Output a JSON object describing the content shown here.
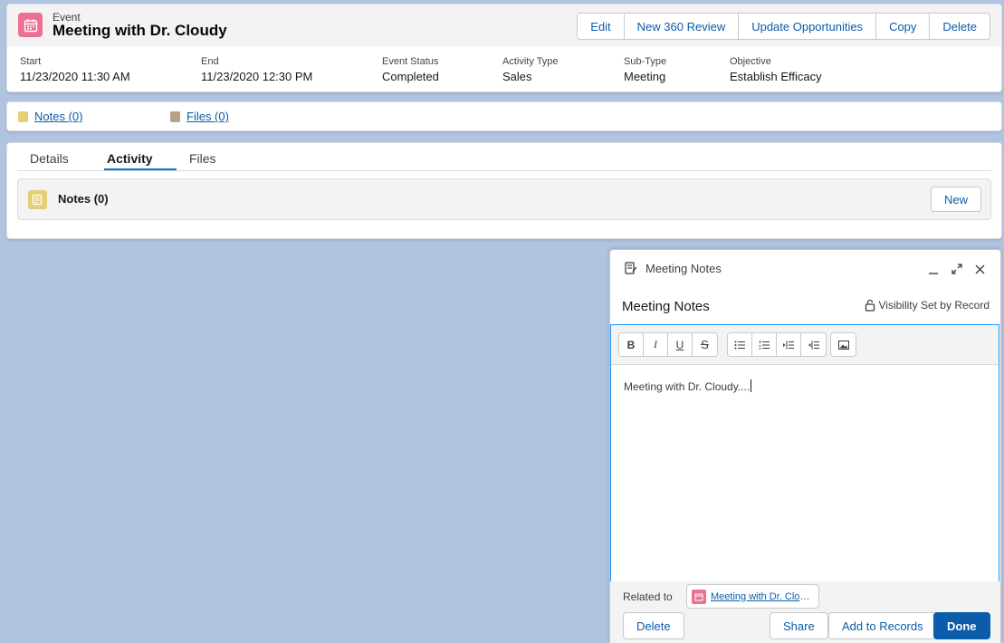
{
  "header": {
    "record_type": "Event",
    "title": "Meeting with Dr. Cloudy",
    "actions": [
      "Edit",
      "New 360 Review",
      "Update Opportunities",
      "Copy",
      "Delete"
    ],
    "fields": [
      {
        "label": "Start",
        "value": "11/23/2020 11:30 AM"
      },
      {
        "label": "End",
        "value": "11/23/2020 12:30 PM"
      },
      {
        "label": "Event Status",
        "value": "Completed"
      },
      {
        "label": "Activity Type",
        "value": "Sales"
      },
      {
        "label": "Sub-Type",
        "value": "Meeting"
      },
      {
        "label": "Objective",
        "value": "Establish Efficacy"
      }
    ]
  },
  "quicklinks": {
    "notes": "Notes (0)",
    "files": "Files (0)"
  },
  "tabs": {
    "items": [
      "Details",
      "Activity",
      "Files"
    ],
    "active": "Activity"
  },
  "notes_section": {
    "title": "Notes (0)",
    "new_label": "New"
  },
  "composer": {
    "header_title": "Meeting Notes",
    "note_title": "Meeting Notes",
    "visibility": "Visibility Set by Record",
    "body": "Meeting with Dr. Cloudy....",
    "related_label": "Related to",
    "related_record": "Meeting with Dr. Cloudy",
    "buttons": {
      "delete": "Delete",
      "share": "Share",
      "add_to_records": "Add to Records",
      "done": "Done"
    }
  },
  "colors": {
    "background": "#b0c4df",
    "event_icon": "#eb7092",
    "note_icon": "#e3d076",
    "link": "#0b5cab",
    "brand": "#0b5cab",
    "focus": "#1b96ff"
  },
  "icons": [
    "event-calendar-icon",
    "note-icon",
    "file-icon",
    "minimize-icon",
    "expand-icon",
    "close-icon",
    "lock-icon",
    "bold-icon",
    "italic-icon",
    "underline-icon",
    "strikethrough-icon",
    "bullet-list-icon",
    "numbered-list-icon",
    "indent-icon",
    "outdent-icon",
    "image-icon"
  ]
}
